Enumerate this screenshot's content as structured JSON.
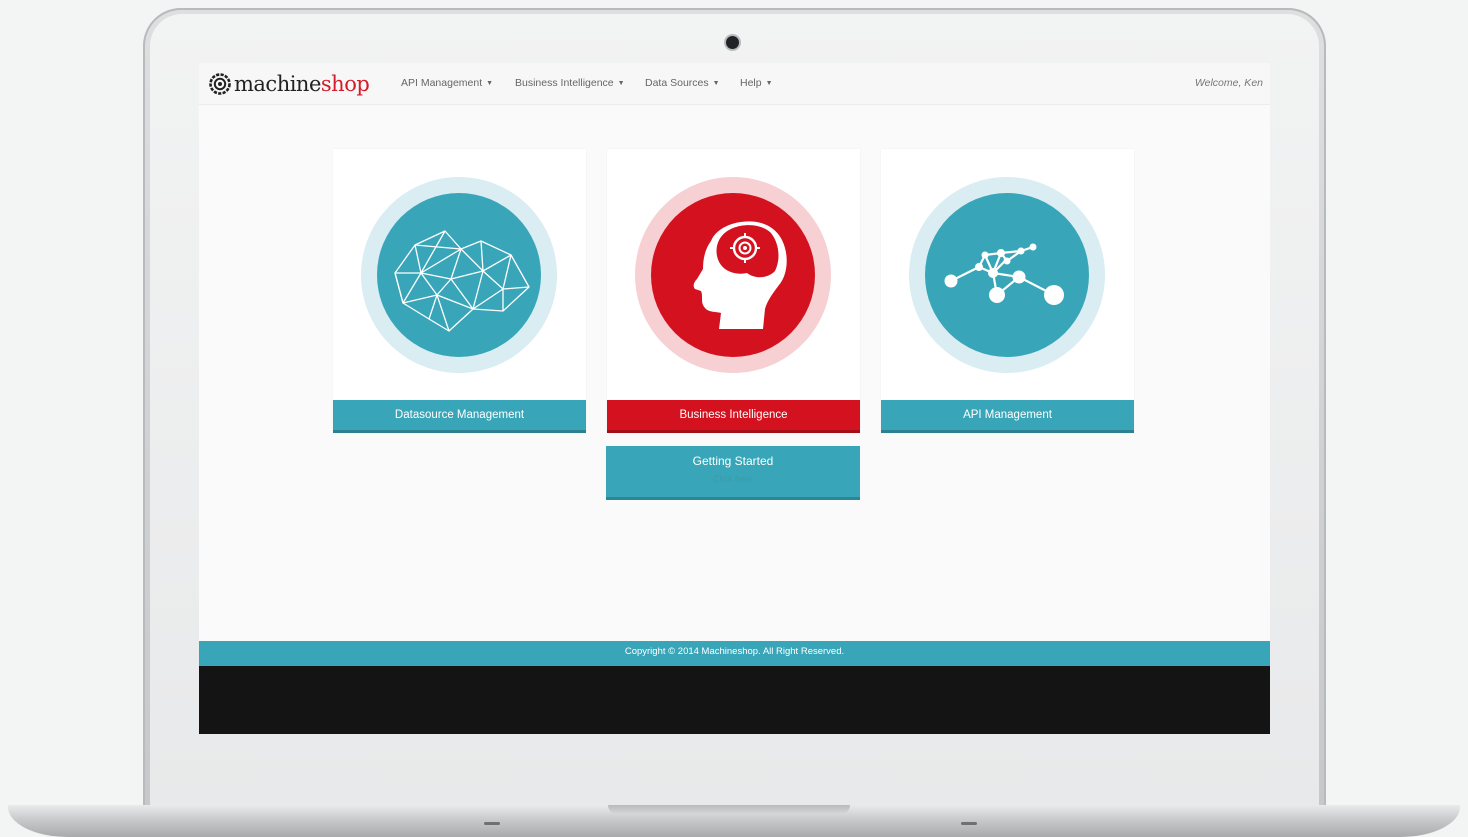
{
  "brand": {
    "name_part1": "machine",
    "name_part2": "shop",
    "logo_icon": "gear-target-icon"
  },
  "nav": {
    "items": [
      {
        "label": "API Management"
      },
      {
        "label": "Business Intelligence"
      },
      {
        "label": "Data Sources"
      },
      {
        "label": "Help"
      }
    ],
    "welcome": "Welcome, Ken"
  },
  "cards": [
    {
      "label": "Datasource Management",
      "icon": "network-map-icon",
      "color": "#38a6b8"
    },
    {
      "label": "Business Intelligence",
      "icon": "brain-head-icon",
      "color": "#d4111e"
    },
    {
      "label": "API Management",
      "icon": "node-graph-icon",
      "color": "#38a6b8"
    }
  ],
  "getting_started": {
    "title": "Getting Started",
    "subtitle": "Click here"
  },
  "footer": {
    "copyright": "Copyright © 2014 Machineshop. All Right Reserved."
  },
  "colors": {
    "accent": "#38a6b8",
    "brand_red": "#d4111e",
    "footer_bg": "#38a6b8"
  }
}
